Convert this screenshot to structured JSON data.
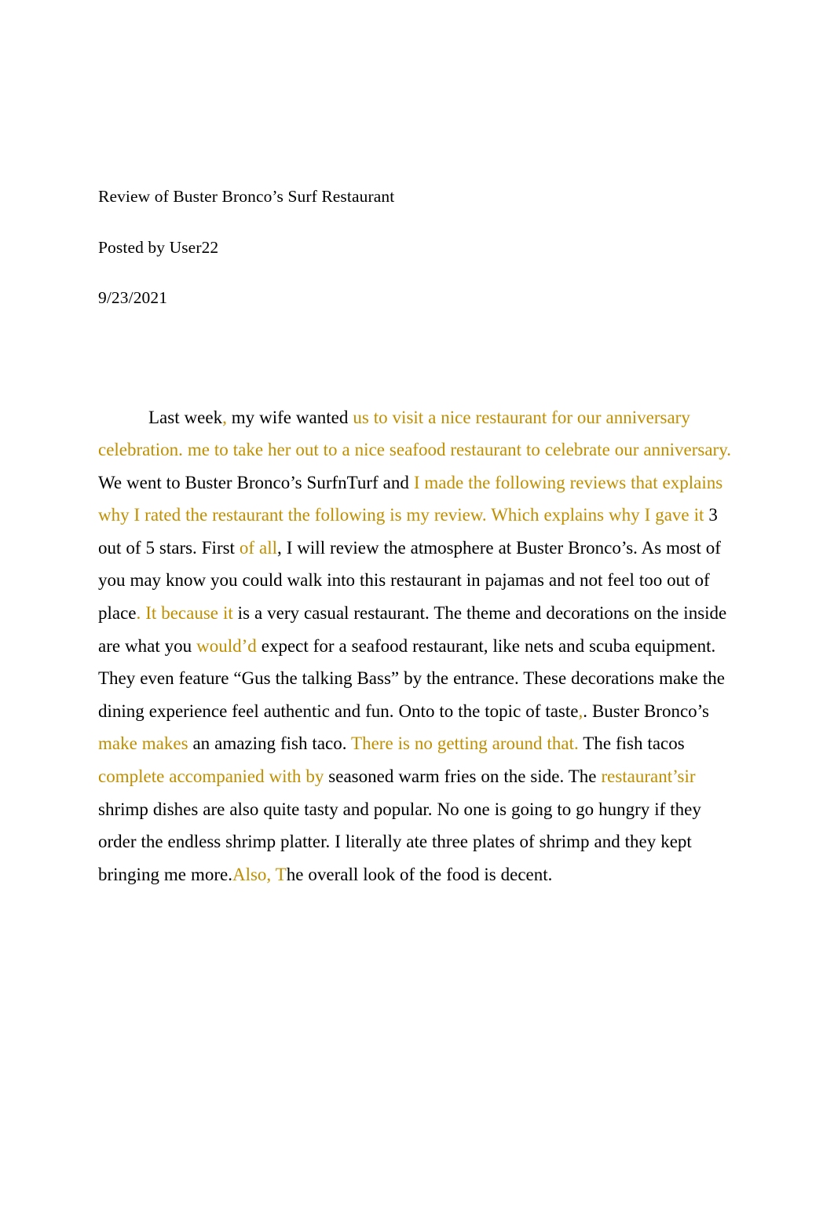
{
  "document": {
    "title_line": "Review of Buster Bronco’s Surf Restaurant",
    "byline": "Posted by User22",
    "date": "9/23/2021"
  },
  "colors": {
    "body_text": "#000000",
    "tracked_edit": "#bf8f00",
    "page_background": "#ffffff"
  },
  "review": {
    "full_text": "Last week, my wife wanted us to visit a nice restaurant for our anniversary celebration. me to take her out to a nice seafood restaurant to celebrate our anniversary. We went to Buster Bronco’s SurfnTurf and I made the following reviews that explains why I rated the restaurant the following is my review. Which explains why I gave it 3 out of 5 stars. First of all, I will review the atmosphere at Buster Bronco’s. As most of you may know you could walk into this restaurant in pajamas and not feel too out of place. It because it is a very casual restaurant. The theme and decorations on the inside are what you would’d expect for a seafood restaurant, like nets and scuba equipment. They even feature “Gus the talking Bass” by the entrance. These decorations make the dining experience feel authentic and fun.  Onto to the topic of taste,. Buster Bronco’s make makes an amazing fish taco. There is no getting around that. The fish tacos complete accompanied with by seasoned warm fries on the side. The restaurant’sir shrimp dishes are also quite tasty and popular. No one is going to go hungry if they order the endless shrimp platter. I literally ate three plates of shrimp and they kept bringing me more.Also, The overall look of the food is decent.",
    "runs": [
      {
        "text": "Last week",
        "style": "orig"
      },
      {
        "text": ",",
        "style": "ins"
      },
      {
        "text": " my wife wanted ",
        "style": "orig"
      },
      {
        "text": "us to visit a nice restaurant for our anniversary celebration. me to take her out to a nice seafood restaurant to celebrate our anniversary.",
        "style": "ins"
      },
      {
        "text": " We went to Buster Bronco’s SurfnTurf and ",
        "style": "orig"
      },
      {
        "text": "I made the following reviews that explains why I rated the restaurant the following is my review. Which explains why I gave it",
        "style": "ins"
      },
      {
        "text": " 3 out of 5 stars. First ",
        "style": "orig"
      },
      {
        "text": "of all",
        "style": "ins"
      },
      {
        "text": ", I will review the atmosphere at Buster Bronco’s. As most of you may know you could walk into this restaurant in pajamas and not feel too out of place",
        "style": "orig"
      },
      {
        "text": ". It because it",
        "style": "ins"
      },
      {
        "text": " is a very casual restaurant. The theme and decorations on the inside are what you ",
        "style": "orig"
      },
      {
        "text": "would’d",
        "style": "ins"
      },
      {
        "text": " expect for a seafood restaurant, like nets and scuba equipment. They even feature “Gus the talking Bass” by the entrance. These decorations make the dining experience feel authentic and fun.  Onto to the topic of taste",
        "style": "orig"
      },
      {
        "text": ",",
        "style": "ins"
      },
      {
        "text": ". Buster Bronco’s ",
        "style": "orig"
      },
      {
        "text": "make makes",
        "style": "ins"
      },
      {
        "text": " an amazing fish taco. ",
        "style": "orig"
      },
      {
        "text": "There is no getting around that.",
        "style": "ins"
      },
      {
        "text": " The fish tacos ",
        "style": "orig"
      },
      {
        "text": "complete accompanied with by",
        "style": "ins"
      },
      {
        "text": " seasoned warm fries on the side. The ",
        "style": "orig"
      },
      {
        "text": "restaurant’sir",
        "style": "ins"
      },
      {
        "text": " shrimp dishes are also quite tasty and popular. No one is going to go hungry if they order the endless shrimp platter. I literally ate three plates of shrimp and they kept bringing me more.",
        "style": "orig"
      },
      {
        "text": "Also, T",
        "style": "ins"
      },
      {
        "text": "he overall look of the food is decent.",
        "style": "orig"
      }
    ]
  }
}
